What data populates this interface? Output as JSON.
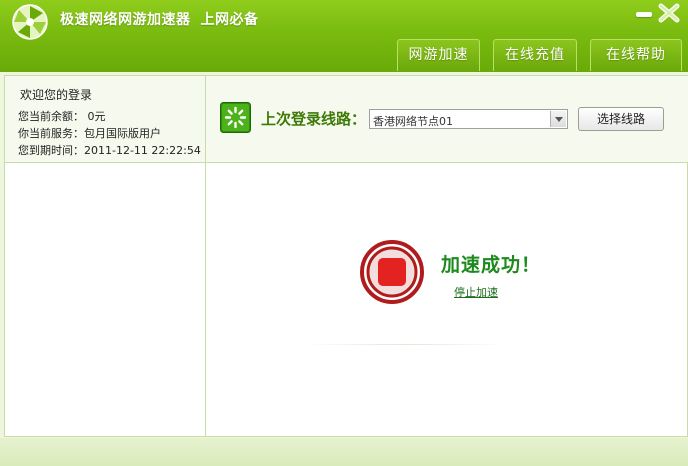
{
  "app": {
    "title": "极速网络网游加速器",
    "slogan": "上网必备"
  },
  "nav": {
    "game_boost": "网游加速",
    "recharge": "在线充值",
    "help": "在线帮助"
  },
  "account": {
    "welcome": "欢迎您的登录",
    "balance": "您当前余额：  0元",
    "service": "你当前服务：包月国际版用户",
    "expire": "您到期时间：2011-12-11 22:22:54"
  },
  "route": {
    "label": "上次登录线路：",
    "selected": "香港网络节点01",
    "select_button": "选择线路"
  },
  "status": {
    "message": "加速成功！",
    "stop_link": "停止加速"
  },
  "colors": {
    "brand_green": "#7abb10",
    "success_green": "#1d8a1d",
    "stop_red": "#b01c1c"
  }
}
